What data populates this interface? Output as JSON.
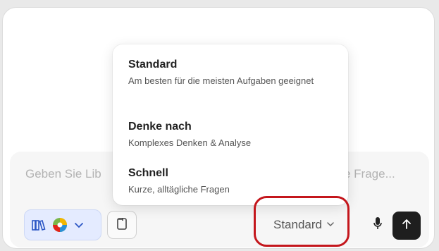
{
  "composer": {
    "placeholder": "Geben Sie Lib… e Frage…",
    "placeholder_left": "Geben Sie Lib",
    "placeholder_right": "e Frage..."
  },
  "toolbar": {
    "model_label": "Standard",
    "icons": [
      "books-icon",
      "globe-icon",
      "chevron-down-icon",
      "attach-icon",
      "mic-icon",
      "arrow-up-icon"
    ]
  },
  "menu": {
    "items": [
      {
        "title": "Standard",
        "desc": "Am besten für die meisten Aufgaben geeignet"
      },
      {
        "title": "Denke nach",
        "desc": "Komplexes Denken & Analyse"
      },
      {
        "title": "Schnell",
        "desc": "Kurze, alltägliche Fragen"
      }
    ]
  },
  "colors": {
    "highlight": "#c4161c",
    "send_button": "#1e1e1e",
    "tools_group_bg": "#e4ebff"
  }
}
